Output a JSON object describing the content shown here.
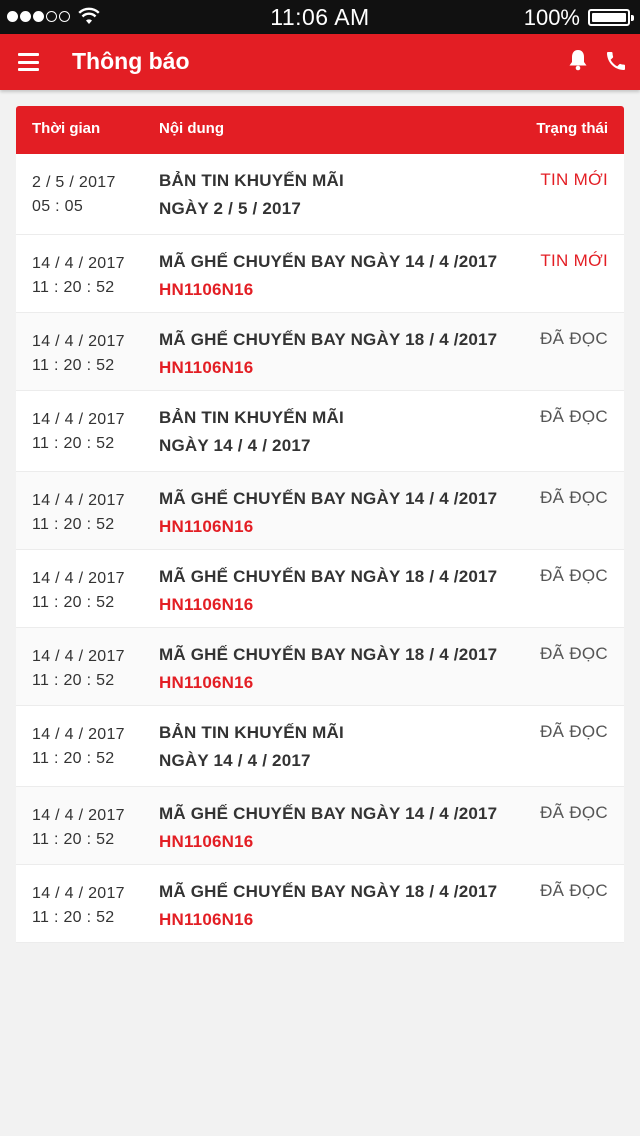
{
  "status_bar": {
    "time": "11:06 AM",
    "battery": "100%"
  },
  "app_bar": {
    "title": "Thông báo",
    "icons": [
      "menu-icon",
      "bell-icon",
      "phone-icon"
    ]
  },
  "colors": {
    "brand_red": "#e31e24",
    "text_dark": "#333333"
  },
  "table": {
    "headers": {
      "time": "Thời gian",
      "content": "Nội dung",
      "status": "Trạng thái"
    },
    "rows": [
      {
        "date": "2 / 5 / 2017",
        "clock": "05 : 05",
        "line1": "BẢN TIN KHUYẾN MÃI",
        "line2": "NGÀY 2 / 5 / 2017",
        "line2_is_code": false,
        "status": "TIN MỚI",
        "is_new": true
      },
      {
        "date": "14 / 4 / 2017",
        "clock": "11 : 20 : 52",
        "line1": "MÃ GHẾ CHUYẾN BAY NGÀY 14 / 4 /2017",
        "line2": "HN1106N16",
        "line2_is_code": true,
        "status": "TIN MỚI",
        "is_new": true
      },
      {
        "date": "14 / 4 / 2017",
        "clock": "11 : 20 : 52",
        "line1": "MÃ GHẾ CHUYẾN BAY NGÀY 18 / 4 /2017",
        "line2": "HN1106N16",
        "line2_is_code": true,
        "status": "ĐÃ ĐỌC",
        "is_new": false
      },
      {
        "date": "14 / 4 / 2017",
        "clock": "11 : 20 : 52",
        "line1": "BẢN TIN KHUYẾN MÃI",
        "line2": "NGÀY 14 / 4 / 2017",
        "line2_is_code": false,
        "status": "ĐÃ ĐỌC",
        "is_new": false
      },
      {
        "date": "14 / 4 / 2017",
        "clock": "11 : 20 : 52",
        "line1": "MÃ GHẾ CHUYẾN BAY NGÀY 14 / 4 /2017",
        "line2": "HN1106N16",
        "line2_is_code": true,
        "status": "ĐÃ ĐỌC",
        "is_new": false
      },
      {
        "date": "14 / 4 / 2017",
        "clock": "11 : 20 : 52",
        "line1": "MÃ GHẾ CHUYẾN BAY NGÀY 18 / 4 /2017",
        "line2": "HN1106N16",
        "line2_is_code": true,
        "status": "ĐÃ ĐỌC",
        "is_new": false
      },
      {
        "date": "14 / 4 / 2017",
        "clock": "11 : 20 : 52",
        "line1": "MÃ GHẾ CHUYẾN BAY NGÀY 18 / 4 /2017",
        "line2": "HN1106N16",
        "line2_is_code": true,
        "status": "ĐÃ ĐỌC",
        "is_new": false
      },
      {
        "date": "14 / 4 / 2017",
        "clock": "11 : 20 : 52",
        "line1": "BẢN TIN KHUYẾN MÃI",
        "line2": "NGÀY 14 / 4 / 2017",
        "line2_is_code": false,
        "status": "ĐÃ ĐỌC",
        "is_new": false
      },
      {
        "date": "14 / 4 / 2017",
        "clock": "11 : 20 : 52",
        "line1": "MÃ GHẾ CHUYẾN BAY NGÀY 14 / 4 /2017",
        "line2": "HN1106N16",
        "line2_is_code": true,
        "status": "ĐÃ ĐỌC",
        "is_new": false
      },
      {
        "date": "14 / 4 / 2017",
        "clock": "11 : 20 : 52",
        "line1": "MÃ GHẾ CHUYẾN BAY NGÀY 18 / 4 /2017",
        "line2": "HN1106N16",
        "line2_is_code": true,
        "status": "ĐÃ ĐỌC",
        "is_new": false
      }
    ]
  }
}
